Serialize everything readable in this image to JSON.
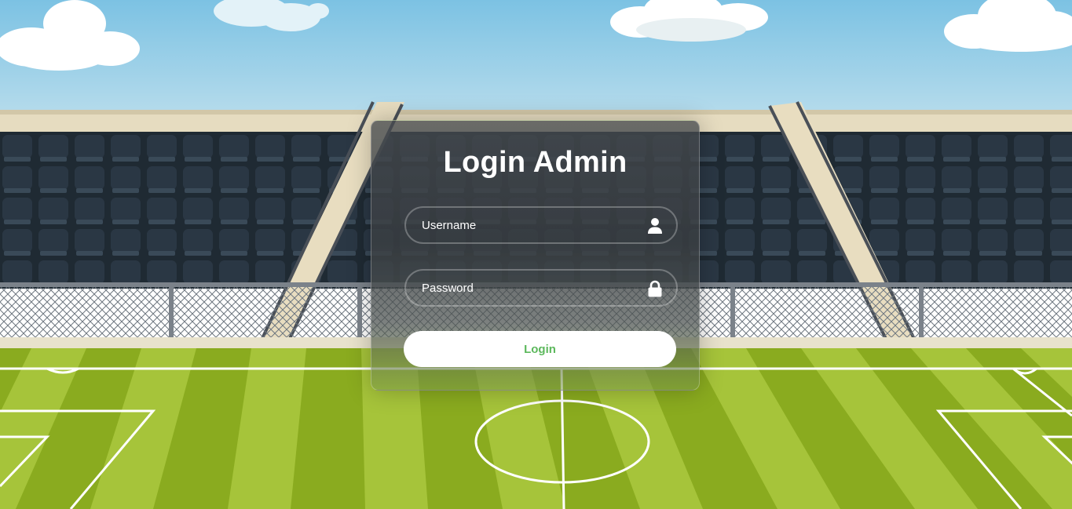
{
  "login": {
    "title": "Login Admin",
    "username_placeholder": "Username",
    "password_placeholder": "Password",
    "button_label": "Login"
  },
  "icons": {
    "username": "user-icon",
    "password": "lock-icon"
  },
  "colors": {
    "button_text": "#5cb85c",
    "button_background": "#ffffff",
    "sky": "#8ccbe6",
    "grass_light": "#a6c43a",
    "grass_dark": "#8aab1f"
  }
}
